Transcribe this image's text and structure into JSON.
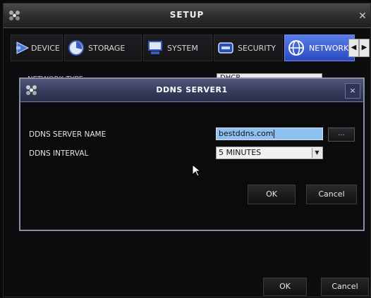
{
  "window": {
    "title": "SETUP",
    "icon": "dvr-app-icon",
    "close_icon": "close-icon"
  },
  "tabs": [
    {
      "label": "DEVICE",
      "icon": "device-icon"
    },
    {
      "label": "STORAGE",
      "icon": "storage-icon"
    },
    {
      "label": "SYSTEM",
      "icon": "system-icon"
    },
    {
      "label": "SECURITY",
      "icon": "security-icon"
    },
    {
      "label": "NETWORK",
      "icon": "network-icon",
      "active": true
    }
  ],
  "tab_scroll": {
    "left": "◀",
    "right": "▶"
  },
  "network": {
    "type_label": "NETWORK TYPE",
    "type_value": "DHCP"
  },
  "footer": {
    "ok_label": "OK",
    "cancel_label": "Cancel"
  },
  "dialog": {
    "title": "DDNS SERVER1",
    "close_label": "×",
    "server_name_label": "DDNS SERVER NAME",
    "server_name_value": "bestddns.com",
    "browse_label": "...",
    "interval_label": "DDNS INTERVAL",
    "interval_value": "5 MINUTES",
    "ok_label": "OK",
    "cancel_label": "Cancel"
  },
  "colors": {
    "active_tab": "#3b5bd6",
    "dialog_title": "#3d4366",
    "input_highlight": "#8fc1f0"
  }
}
